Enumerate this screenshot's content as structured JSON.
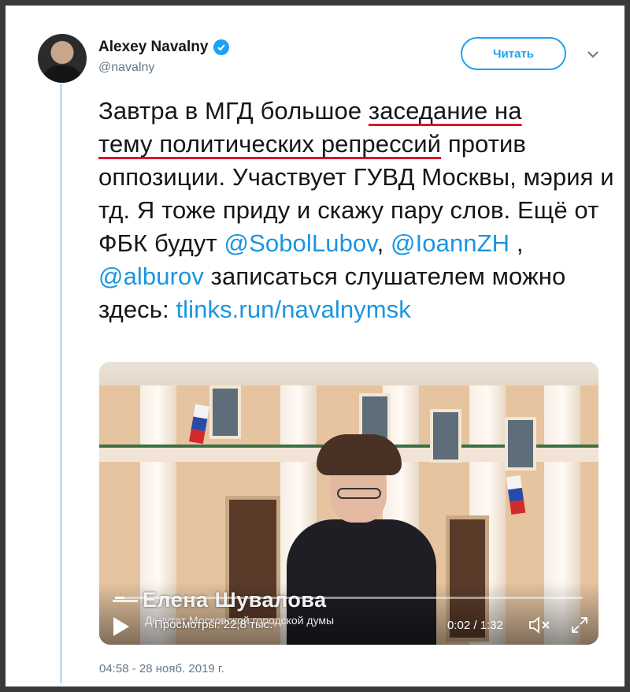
{
  "author": {
    "name": "Alexey Navalny",
    "handle": "@navalny",
    "verified_badge_icon": "verified-checkmark-icon"
  },
  "follow_button": {
    "label": "Читать"
  },
  "tweet": {
    "text_parts": {
      "p1": "Завтра в МГД большое ",
      "u1": "заседание на",
      "u2": "тему политических репрессий",
      "p2": " против оппозиции. Участвует ГУВД Москвы, мэрия и тд. Я тоже приду и скажу пару слов. Ещё от ФБК будут ",
      "mention1": "@SobolLubov",
      "p3": ", ",
      "mention2": "@IoannZH",
      "p4": " , ",
      "mention3": "@alburov",
      "p5": " записаться слушателем можно здесь: ",
      "link": "tlinks.run/navalnymsk"
    },
    "timestamp": "04:58 - 28 нояб. 2019 г."
  },
  "video": {
    "overlay_name": "Елена Шувалова",
    "overlay_subtitle": "Депутат Московской городской думы",
    "views": "Просмотры: 22,8 тыс.",
    "time": "0:02 / 1:32",
    "progress_fraction": 0.021
  },
  "colors": {
    "link": "#1b95e0",
    "verified": "#1da1f2",
    "underline_annotation": "#d8192b",
    "secondary_text": "#657786"
  }
}
